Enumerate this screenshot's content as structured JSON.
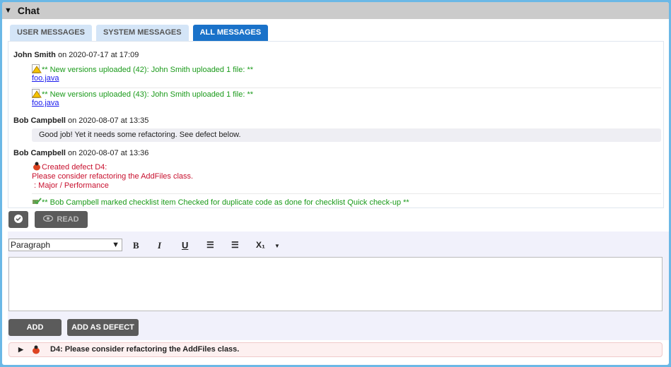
{
  "panel": {
    "title": "Chat"
  },
  "tabs": [
    {
      "label": "USER MESSAGES"
    },
    {
      "label": "SYSTEM MESSAGES"
    },
    {
      "label": "ALL MESSAGES",
      "active": true
    }
  ],
  "messages": [
    {
      "author": "John Smith",
      "meta": "on 2020-07-17 at 17:09",
      "items": [
        {
          "icon": "warning-file-icon",
          "text": "** New versions uploaded (42): John Smith uploaded 1 file: **",
          "link": "foo.java"
        },
        {
          "icon": "warning-file-icon",
          "text": "** New versions uploaded (43): John Smith uploaded 1 file: **",
          "link": "foo.java"
        }
      ]
    },
    {
      "author": "Bob Campbell",
      "meta": "on 2020-08-07 at 13:35",
      "text": "Good job! Yet it needs some refactoring. See defect below."
    },
    {
      "author": "Bob Campbell",
      "meta": "on 2020-08-07 at 13:36",
      "defect": {
        "line1": "Created defect D4:",
        "line2": "Please consider refactoring the AddFiles class.",
        "line3": " : Major / Performance"
      },
      "checklist": "** Bob Campbell marked checklist item Checked for duplicate code as done for checklist Quick check-up **"
    }
  ],
  "actions": {
    "read": "READ"
  },
  "editor": {
    "format": "Paragraph",
    "bold": "B",
    "italic": "I",
    "underline": "U",
    "subscript": "X₁"
  },
  "buttons": {
    "add": "ADD",
    "add_defect": "ADD AS DEFECT"
  },
  "defect_summary": "D4: Please consider refactoring the AddFiles class.",
  "colors": {
    "accent": "#1a72c9",
    "system_text": "#1a9a1a",
    "defect_text": "#c8102e"
  }
}
